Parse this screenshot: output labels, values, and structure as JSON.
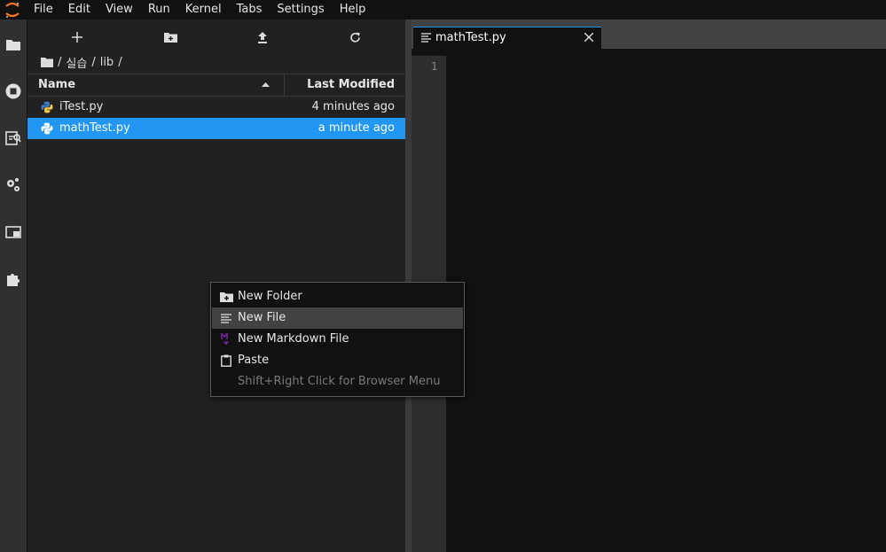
{
  "menubar": {
    "items": [
      "File",
      "Edit",
      "View",
      "Run",
      "Kernel",
      "Tabs",
      "Settings",
      "Help"
    ]
  },
  "activity_bar": {
    "icons": [
      "folder-icon",
      "running-icon",
      "property-inspector-icon",
      "debugger-icon",
      "tabs-icon",
      "extension-icon"
    ]
  },
  "browser": {
    "toolbar": [
      "new-launcher-icon",
      "new-folder-icon",
      "upload-icon",
      "refresh-icon"
    ],
    "breadcrumb": [
      "/",
      "실습",
      "/",
      "lib",
      "/"
    ],
    "columns": {
      "name": "Name",
      "modified": "Last Modified"
    },
    "files": [
      {
        "name": "iTest.py",
        "modified": "4 minutes ago",
        "selected": false
      },
      {
        "name": "mathTest.py",
        "modified": "a minute ago",
        "selected": true
      }
    ]
  },
  "editor": {
    "tab_label": "mathTest.py",
    "line_numbers": [
      "1"
    ]
  },
  "context_menu": {
    "items": [
      {
        "label": "New Folder",
        "icon": "new-folder-icon",
        "hover": false,
        "disabled": false
      },
      {
        "label": "New File",
        "icon": "text-file-icon",
        "hover": true,
        "disabled": false
      },
      {
        "label": "New Markdown File",
        "icon": "markdown-icon",
        "hover": false,
        "disabled": false
      },
      {
        "label": "Paste",
        "icon": "paste-icon",
        "hover": false,
        "disabled": false
      },
      {
        "label": "Shift+Right Click for Browser Menu",
        "icon": "",
        "hover": false,
        "disabled": true
      }
    ]
  },
  "colors": {
    "accent": "#2196f3",
    "background": "#111111",
    "panel": "#212121",
    "markdown": "#7b1fa2",
    "python_blue": "#3b7bbf",
    "python_yellow": "#f7c948"
  }
}
